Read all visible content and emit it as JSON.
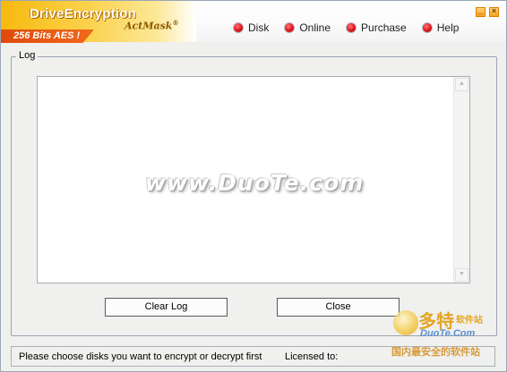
{
  "app": {
    "title": "DriveEncryption",
    "subtitle": "ActMask",
    "subtitle_mark": "®",
    "aes_tag": "256 Bits AES !"
  },
  "menu": {
    "items": [
      {
        "label": "Disk",
        "icon": "red-bullet-icon"
      },
      {
        "label": "Online",
        "icon": "red-bullet-icon"
      },
      {
        "label": "Purchase",
        "icon": "red-bullet-icon"
      },
      {
        "label": "Help",
        "icon": "red-bullet-icon"
      }
    ]
  },
  "window_buttons": {
    "minimize": "_",
    "close": "×"
  },
  "log": {
    "legend": "Log",
    "content": ""
  },
  "watermark": "www.DuoTe.com",
  "buttons": {
    "clear_log": "Clear Log",
    "close": "Close"
  },
  "status": {
    "message": "Please choose disks you want to encrypt or decrypt first",
    "licensed_label": "Licensed to:"
  },
  "corner_badge": {
    "big": "多特",
    "small": "软件站",
    "en": "DuoTe.Com",
    "cn": "国内最安全的软件站"
  },
  "colors": {
    "brand_orange": "#f7b90e",
    "aes_red": "#e0490c",
    "bullet_red": "#e0101a"
  }
}
